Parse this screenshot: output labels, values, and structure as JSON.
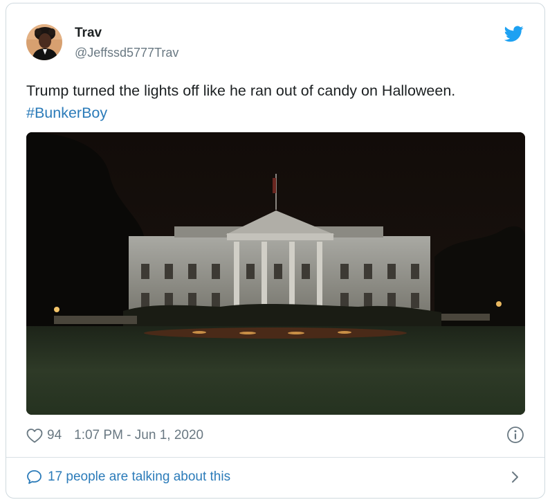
{
  "tweet": {
    "author": {
      "display_name": "Trav",
      "handle": "@Jeffssd5777Trav",
      "avatar": "avatar"
    },
    "platform_icon": "twitter-bird-icon",
    "text_main": "Trump turned the lights off like he ran out of candy on Halloween.",
    "hashtag": "#BunkerBoy",
    "media": {
      "type": "photo"
    },
    "likes": "94",
    "timestamp": "1:07 PM - Jun 1, 2020",
    "conversation_label": "17 people are talking about this"
  },
  "colors": {
    "text": "#1c2022",
    "secondary": "#697882",
    "link": "#2b7bb9",
    "twitter_blue": "#1da1f2",
    "border": "#cfd9de"
  }
}
